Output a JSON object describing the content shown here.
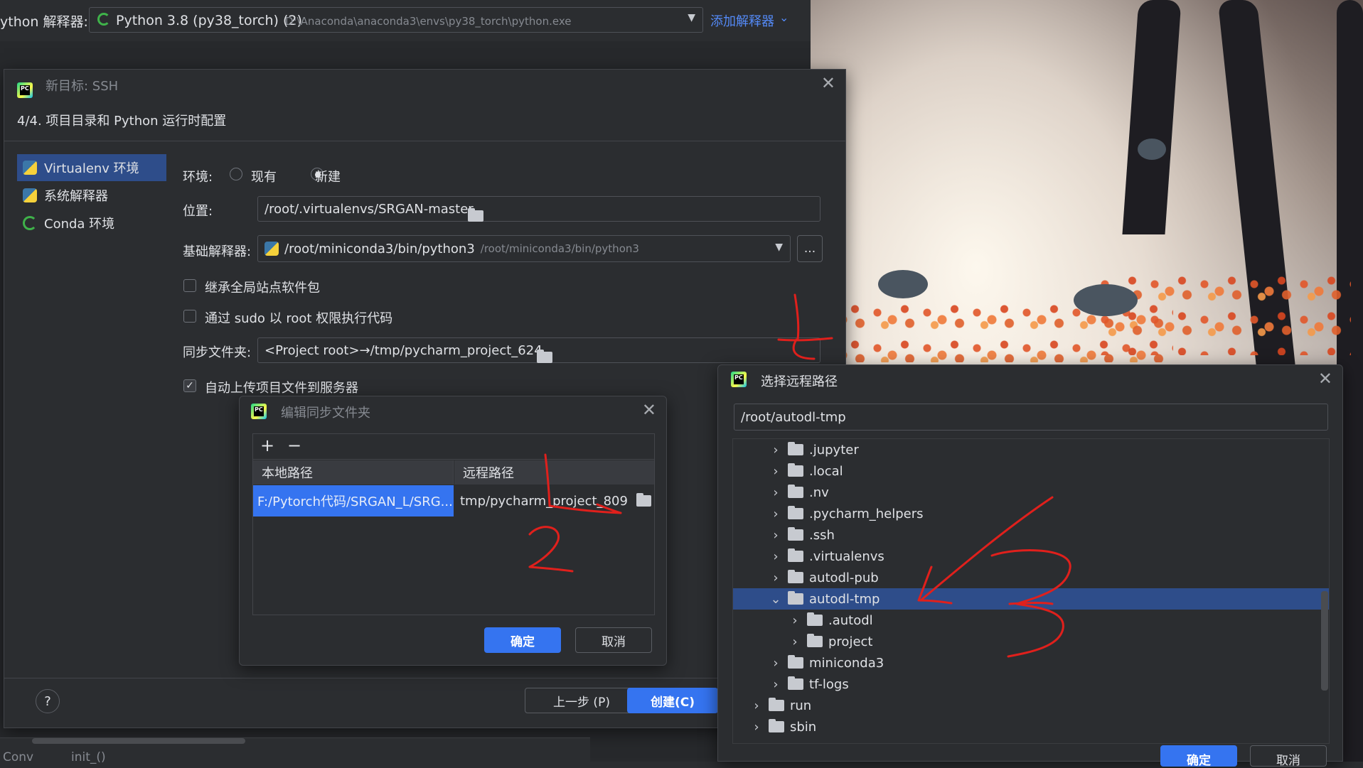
{
  "top": {
    "interpreter_label": "ython 解释器:",
    "interpreter_name": "Python 3.8 (py38_torch) (2)",
    "interpreter_path": "D:\\Anaconda\\anaconda3\\envs\\py38_torch\\python.exe",
    "add_interpreter": "添加解释器"
  },
  "ssh_dialog": {
    "title": "新目标: SSH",
    "step": "4/4. 项目目录和 Python 运行时配置",
    "sidebar": [
      {
        "label": "Virtualenv 环境",
        "icon": "python-icon"
      },
      {
        "label": "系统解释器",
        "icon": "python-icon"
      },
      {
        "label": "Conda 环境",
        "icon": "conda-icon"
      }
    ],
    "env_label": "环境:",
    "env_existing": "现有",
    "env_new": "新建",
    "location_label": "位置:",
    "location_value": "/root/.virtualenvs/SRGAN-master",
    "base_label": "基础解释器:",
    "base_value": "/root/miniconda3/bin/python3",
    "base_hint": "/root/miniconda3/bin/python3",
    "browse": "...",
    "inherit_label": "继承全局站点软件包",
    "sudo_label": "通过 sudo 以 root 权限执行代码",
    "sync_label": "同步文件夹:",
    "sync_value": "<Project root>→/tmp/pycharm_project_624",
    "auto_upload_label": "自动上传项目文件到服务器",
    "help": "?",
    "prev_button": "上一步 (P)",
    "create_button": "创建(C)"
  },
  "sync_dialog": {
    "title": "编辑同步文件夹",
    "add": "+",
    "remove": "−",
    "col_local": "本地路径",
    "col_remote": "远程路径",
    "row_local": "F:/Pytorch代码/SRGAN_L/SRG...",
    "row_remote": "tmp/pycharm_project_809",
    "ok": "确定",
    "cancel": "取消"
  },
  "remote_dialog": {
    "title": "选择远程路径",
    "path": "/root/autodl-tmp",
    "items": [
      {
        "label": ".jupyter",
        "level": 1,
        "expanded": false,
        "selected": false
      },
      {
        "label": ".local",
        "level": 1,
        "expanded": false,
        "selected": false
      },
      {
        "label": ".nv",
        "level": 1,
        "expanded": false,
        "selected": false
      },
      {
        "label": ".pycharm_helpers",
        "level": 1,
        "expanded": false,
        "selected": false
      },
      {
        "label": ".ssh",
        "level": 1,
        "expanded": false,
        "selected": false
      },
      {
        "label": ".virtualenvs",
        "level": 1,
        "expanded": false,
        "selected": false
      },
      {
        "label": "autodl-pub",
        "level": 1,
        "expanded": false,
        "selected": false
      },
      {
        "label": "autodl-tmp",
        "level": 1,
        "expanded": true,
        "selected": true
      },
      {
        "label": ".autodl",
        "level": 2,
        "expanded": false,
        "selected": false
      },
      {
        "label": "project",
        "level": 2,
        "expanded": false,
        "selected": false
      },
      {
        "label": "miniconda3",
        "level": 1,
        "expanded": false,
        "selected": false
      },
      {
        "label": "tf-logs",
        "level": 1,
        "expanded": false,
        "selected": false
      },
      {
        "label": "run",
        "level": 0,
        "expanded": false,
        "selected": false
      },
      {
        "label": "sbin",
        "level": 0,
        "expanded": false,
        "selected": false
      }
    ],
    "ok": "确定",
    "cancel": "取消"
  },
  "bottom": {
    "left_text": "Conv",
    "init_text": "init_()"
  },
  "colors": {
    "accent": "#3574f0",
    "selection": "#2e4d8a",
    "annotation": "#e0201c"
  }
}
